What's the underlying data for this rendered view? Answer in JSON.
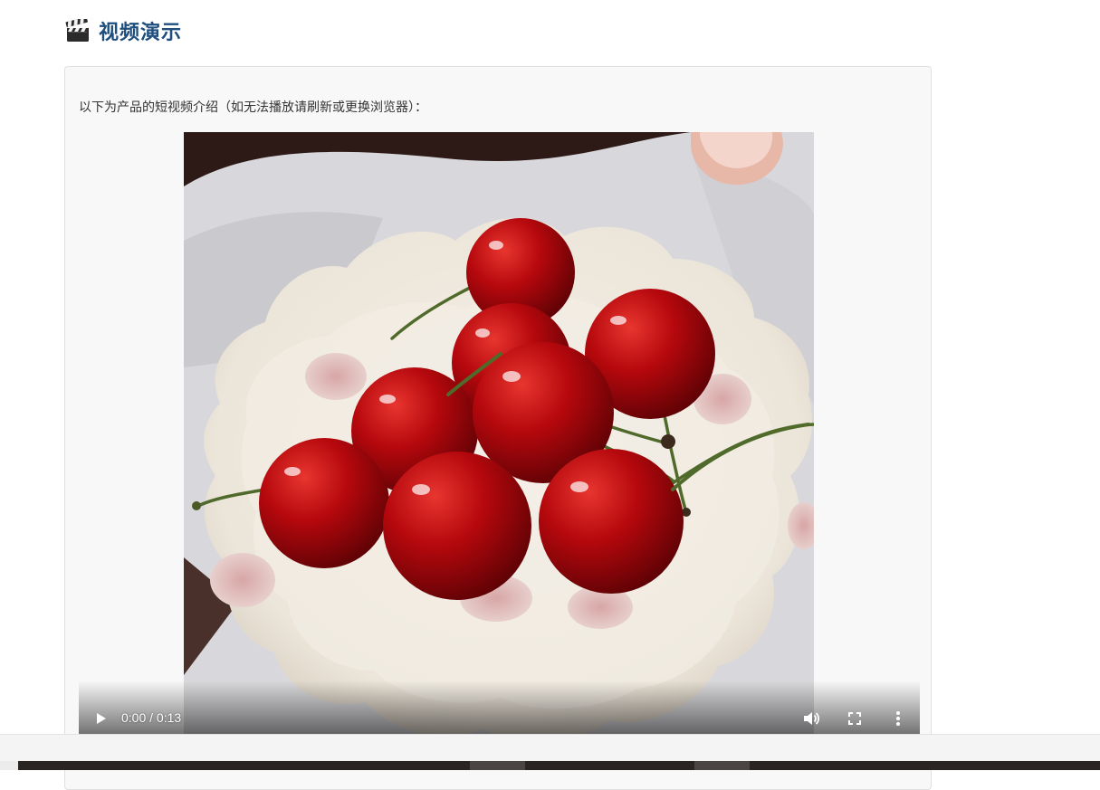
{
  "section": {
    "icon": "clapperboard-icon",
    "title": "视频演示"
  },
  "card": {
    "intro": "以下为产品的短视频介绍（如无法播放请刷新或更换浏览器）："
  },
  "video": {
    "subject": "cherries on scalloped plate",
    "current_time": "0:00",
    "duration": "0:13",
    "time_display": "0:00 / 0:13",
    "progress": 0.0,
    "controls": {
      "play_icon": "play-icon",
      "volume_icon": "volume-icon",
      "fullscreen_icon": "fullscreen-icon",
      "more_icon": "more-options-icon"
    }
  },
  "colors": {
    "title": "#1d4e7d",
    "card_bg": "#f8f8f8",
    "cherry": "#b5080d"
  }
}
